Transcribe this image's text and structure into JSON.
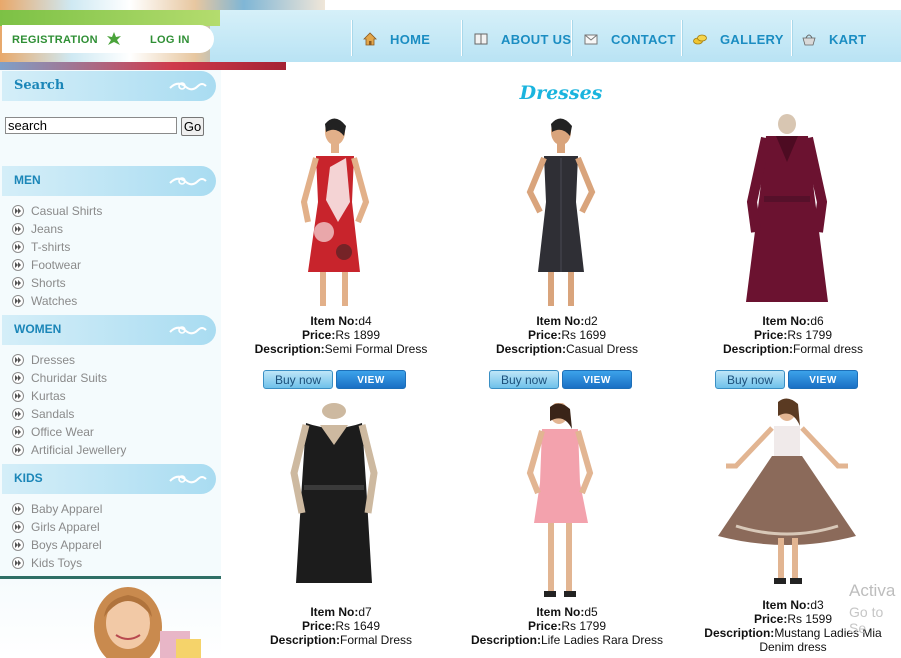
{
  "header": {
    "registration": "REGISTRATION",
    "login": "LOG IN",
    "nav": [
      {
        "label": "HOME",
        "icon": "home-icon"
      },
      {
        "label": "ABOUT US",
        "icon": "book-icon"
      },
      {
        "label": "CONTACT",
        "icon": "envelope-icon"
      },
      {
        "label": "GALLERY",
        "icon": "coins-icon"
      },
      {
        "label": "KART",
        "icon": "basket-icon"
      }
    ]
  },
  "sidebar": {
    "search_title": "Search",
    "search_value": "search",
    "search_button": "Go",
    "sections": [
      {
        "title": "MEN",
        "items": [
          "Casual Shirts",
          "Jeans",
          "T-shirts",
          "Footwear",
          "Shorts",
          "Watches"
        ]
      },
      {
        "title": "WOMEN",
        "items": [
          "Dresses",
          "Churidar Suits",
          "Kurtas",
          "Sandals",
          "Office Wear",
          "Artificial Jewellery"
        ]
      },
      {
        "title": "KIDS",
        "items": [
          "Baby Apparel",
          "Girls Apparel",
          "Boys Apparel",
          "Kids Toys"
        ]
      }
    ]
  },
  "main": {
    "title": "Dresses",
    "labels": {
      "item": "Item No:",
      "price": "Price:",
      "description": "Description:"
    },
    "buy_label": "Buy now",
    "view_label": "VIEW",
    "products": [
      {
        "item": "d4",
        "price": "Rs 1899",
        "description": "Semi Formal Dress",
        "color": "#c8242c"
      },
      {
        "item": "d2",
        "price": "Rs 1699",
        "description": "Casual Dress",
        "color": "#2f2f35"
      },
      {
        "item": "d6",
        "price": "Rs 1799",
        "description": "Formal dress",
        "color": "#6b1230"
      },
      {
        "item": "d7",
        "price": "Rs 1649",
        "description": "Formal Dress",
        "color": "#1c1c1c"
      },
      {
        "item": "d5",
        "price": "Rs 1799",
        "description": "Life Ladies Rara Dress",
        "color": "#f3a2ad"
      },
      {
        "item": "d3",
        "price": "Rs 1599",
        "description": "Mustang Ladies Mia Denim dress",
        "color": "#8b6a5a"
      }
    ]
  },
  "watermark": {
    "line1": "Activa",
    "line2": "Go to Se"
  }
}
